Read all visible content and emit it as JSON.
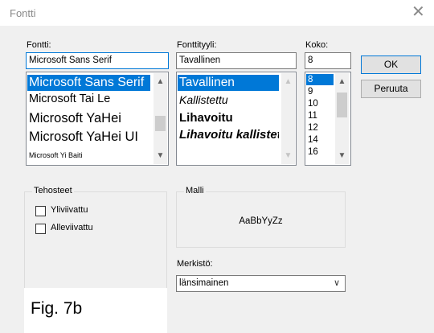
{
  "window": {
    "title": "Fontti",
    "close_symbol": "✕"
  },
  "font": {
    "label": "Fontti:",
    "value": "Microsoft Sans Serif",
    "items": [
      {
        "label": "Microsoft Sans Serif",
        "selected": true
      },
      {
        "label": "Microsoft Tai Le",
        "selected": false
      },
      {
        "label": "Microsoft YaHei",
        "selected": false
      },
      {
        "label": "Microsoft YaHei UI",
        "selected": false
      },
      {
        "label": "Microsoft Yi Baiti",
        "selected": false
      }
    ]
  },
  "style": {
    "label": "Fonttityyli:",
    "value": "Tavallinen",
    "items": [
      {
        "label": "Tavallinen",
        "selected": true
      },
      {
        "label": "Kallistettu",
        "selected": false
      },
      {
        "label": "Lihavoitu",
        "selected": false
      },
      {
        "label": "Lihavoitu kallistettu",
        "selected": false
      }
    ]
  },
  "size": {
    "label": "Koko:",
    "value": "8",
    "items": [
      {
        "label": "8",
        "selected": true
      },
      {
        "label": "9",
        "selected": false
      },
      {
        "label": "10",
        "selected": false
      },
      {
        "label": "11",
        "selected": false
      },
      {
        "label": "12",
        "selected": false
      },
      {
        "label": "14",
        "selected": false
      },
      {
        "label": "16",
        "selected": false
      }
    ]
  },
  "buttons": {
    "ok": "OK",
    "cancel": "Peruuta"
  },
  "effects": {
    "title": "Tehosteet",
    "strikeout": {
      "label": "Yliviivattu",
      "checked": false
    },
    "underline": {
      "label": "Alleviivattu",
      "checked": false
    }
  },
  "sample": {
    "title": "Malli",
    "text": "AaBbYyZz"
  },
  "script": {
    "label": "Merkistö:",
    "value": "länsimainen"
  },
  "figure_label": "Fig. 7b",
  "colors": {
    "selection": "#0078d7",
    "dialog_bg": "#f0f0f0",
    "focus_border": "#0078d7"
  }
}
